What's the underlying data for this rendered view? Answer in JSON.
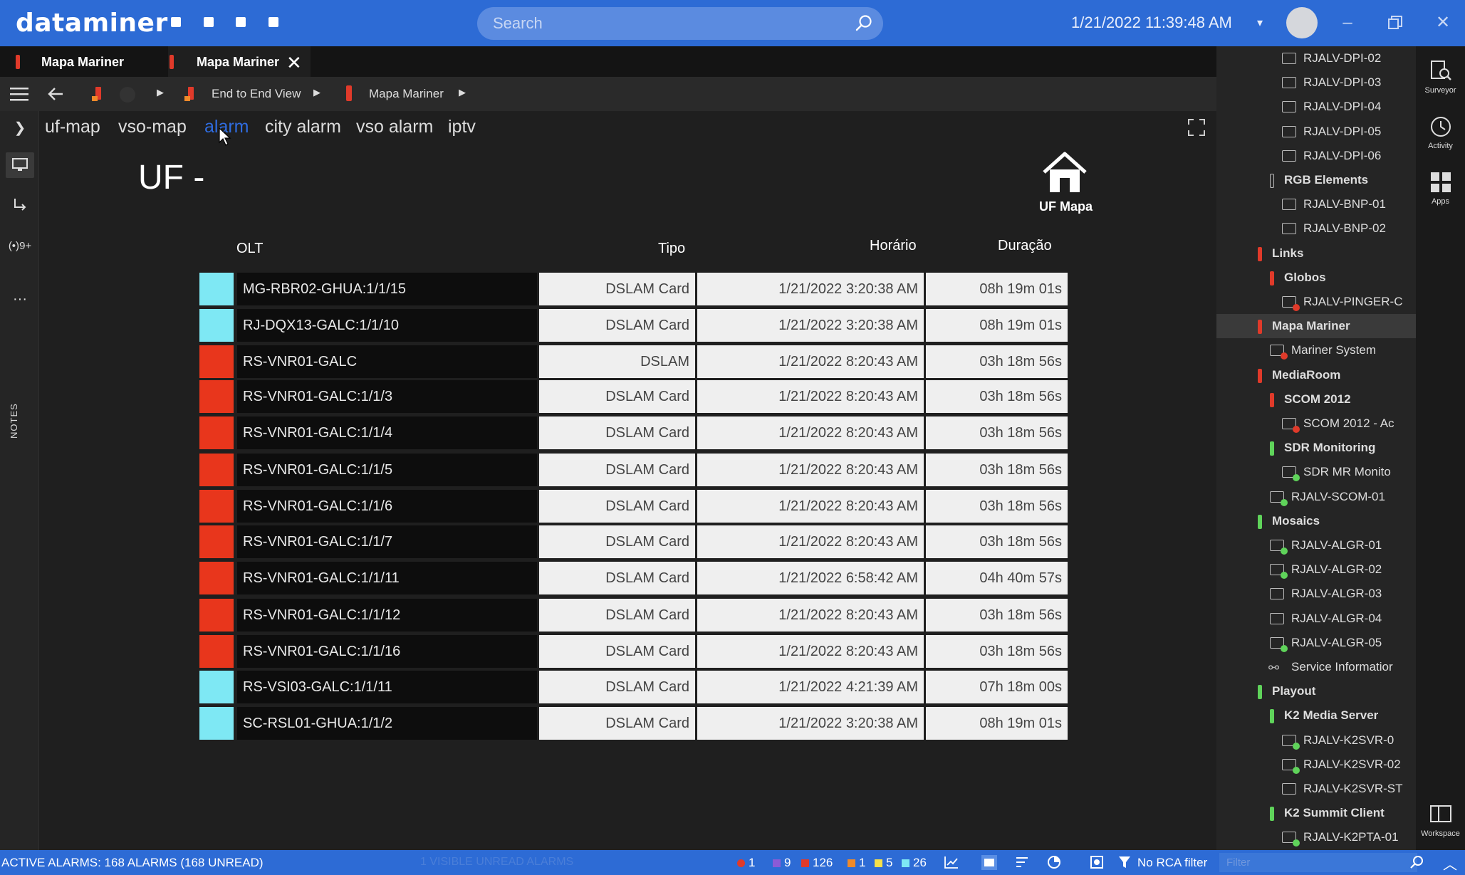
{
  "app": {
    "logo": "dataminer"
  },
  "header": {
    "search_placeholder": "Search",
    "datetime": "1/21/2022 11:39:48 AM"
  },
  "tabs": [
    {
      "label": "Mapa Mariner",
      "active": false
    },
    {
      "label": "Mapa Mariner",
      "active": true
    }
  ],
  "breadcrumb": [
    {
      "label": "End to End View"
    },
    {
      "label": "Mapa Mariner"
    }
  ],
  "nav": {
    "links": [
      "uf-map",
      "vso-map",
      "alarm",
      "city alarm",
      "vso alarm",
      "iptv"
    ],
    "active": "alarm"
  },
  "leftrail": {
    "badge": "9+",
    "notes": "NOTES"
  },
  "page": {
    "title": "UF -",
    "home_label": "UF Mapa"
  },
  "table": {
    "headers": {
      "olt": "OLT",
      "tipo": "Tipo",
      "horario": "Horário",
      "duracao": "Duração"
    },
    "rows": [
      {
        "color": "#7ee8f4",
        "olt": "MG-RBR02-GHUA:1/1/15",
        "tipo": "DSLAM Card",
        "horario": "1/21/2022 3:20:38 AM",
        "duracao": "08h 19m 01s"
      },
      {
        "color": "#7ee8f4",
        "olt": "RJ-DQX13-GALC:1/1/10",
        "tipo": "DSLAM Card",
        "horario": "1/21/2022 3:20:38 AM",
        "duracao": "08h 19m 01s"
      },
      {
        "color": "#e8361c",
        "olt": "RS-VNR01-GALC",
        "tipo": "DSLAM",
        "horario": "1/21/2022 8:20:43 AM",
        "duracao": "03h 18m 56s"
      },
      {
        "color": "#e8361c",
        "olt": "RS-VNR01-GALC:1/1/3",
        "tipo": "DSLAM Card",
        "horario": "1/21/2022 8:20:43 AM",
        "duracao": "03h 18m 56s"
      },
      {
        "color": "#e8361c",
        "olt": "RS-VNR01-GALC:1/1/4",
        "tipo": "DSLAM Card",
        "horario": "1/21/2022 8:20:43 AM",
        "duracao": "03h 18m 56s"
      },
      {
        "color": "#e8361c",
        "olt": "RS-VNR01-GALC:1/1/5",
        "tipo": "DSLAM Card",
        "horario": "1/21/2022 8:20:43 AM",
        "duracao": "03h 18m 56s"
      },
      {
        "color": "#e8361c",
        "olt": "RS-VNR01-GALC:1/1/6",
        "tipo": "DSLAM Card",
        "horario": "1/21/2022 8:20:43 AM",
        "duracao": "03h 18m 56s"
      },
      {
        "color": "#e8361c",
        "olt": "RS-VNR01-GALC:1/1/7",
        "tipo": "DSLAM Card",
        "horario": "1/21/2022 8:20:43 AM",
        "duracao": "03h 18m 56s"
      },
      {
        "color": "#e8361c",
        "olt": "RS-VNR01-GALC:1/1/11",
        "tipo": "DSLAM Card",
        "horario": "1/21/2022 6:58:42 AM",
        "duracao": "04h 40m 57s"
      },
      {
        "color": "#e8361c",
        "olt": "RS-VNR01-GALC:1/1/12",
        "tipo": "DSLAM Card",
        "horario": "1/21/2022 8:20:43 AM",
        "duracao": "03h 18m 56s"
      },
      {
        "color": "#e8361c",
        "olt": "RS-VNR01-GALC:1/1/16",
        "tipo": "DSLAM Card",
        "horario": "1/21/2022 8:20:43 AM",
        "duracao": "03h 18m 56s"
      },
      {
        "color": "#7ee8f4",
        "olt": "RS-VSI03-GALC:1/1/11",
        "tipo": "DSLAM Card",
        "horario": "1/21/2022 4:21:39 AM",
        "duracao": "07h 18m 00s"
      },
      {
        "color": "#7ee8f4",
        "olt": "SC-RSL01-GHUA:1/1/2",
        "tipo": "DSLAM Card",
        "horario": "1/21/2022 3:20:38 AM",
        "duracao": "08h 19m 01s"
      }
    ]
  },
  "tree": [
    {
      "level": 3,
      "kind": "element",
      "label": "RJALV-DPI-02",
      "dot": ""
    },
    {
      "level": 3,
      "kind": "element",
      "label": "RJALV-DPI-03",
      "dot": ""
    },
    {
      "level": 3,
      "kind": "element",
      "label": "RJALV-DPI-04",
      "dot": ""
    },
    {
      "level": 3,
      "kind": "element",
      "label": "RJALV-DPI-05",
      "dot": ""
    },
    {
      "level": 3,
      "kind": "element",
      "label": "RJALV-DPI-06",
      "dot": ""
    },
    {
      "level": 2,
      "kind": "view",
      "label": "RGB Elements",
      "bar": "#2a2a2a",
      "bold": true
    },
    {
      "level": 3,
      "kind": "element",
      "label": "RJALV-BNP-01",
      "dot": ""
    },
    {
      "level": 3,
      "kind": "element",
      "label": "RJALV-BNP-02",
      "dot": ""
    },
    {
      "level": 1,
      "kind": "view",
      "label": "Links",
      "bar": "#e03a2a",
      "bold": true
    },
    {
      "level": 2,
      "kind": "view",
      "label": "Globos",
      "bar": "#e03a2a",
      "bold": true
    },
    {
      "level": 3,
      "kind": "element",
      "label": "RJALV-PINGER-C",
      "dot": "#e03a2a"
    },
    {
      "level": 1,
      "kind": "view",
      "label": "Mapa Mariner",
      "bar": "#e03a2a",
      "bold": true,
      "selected": true
    },
    {
      "level": 2,
      "kind": "element",
      "label": "Mariner System",
      "dot": "#e03a2a"
    },
    {
      "level": 1,
      "kind": "view",
      "label": "MediaRoom",
      "bar": "#e03a2a",
      "bold": true
    },
    {
      "level": 2,
      "kind": "view",
      "label": "SCOM 2012",
      "bar": "#e03a2a",
      "bold": true
    },
    {
      "level": 3,
      "kind": "element",
      "label": "SCOM 2012 - Ac",
      "dot": "#e03a2a"
    },
    {
      "level": 2,
      "kind": "view",
      "label": "SDR Monitoring",
      "bar": "#5fd35a",
      "bold": true
    },
    {
      "level": 3,
      "kind": "element",
      "label": "SDR MR Monito",
      "dot": "#5fd35a"
    },
    {
      "level": 2,
      "kind": "element",
      "label": "RJALV-SCOM-01",
      "dot": "#5fd35a"
    },
    {
      "level": 1,
      "kind": "view",
      "label": "Mosaics",
      "bar": "#5fd35a",
      "bold": true
    },
    {
      "level": 2,
      "kind": "element",
      "label": "RJALV-ALGR-01",
      "dot": "#5fd35a"
    },
    {
      "level": 2,
      "kind": "element",
      "label": "RJALV-ALGR-02",
      "dot": "#5fd35a"
    },
    {
      "level": 2,
      "kind": "element",
      "label": "RJALV-ALGR-03",
      "dot": ""
    },
    {
      "level": 2,
      "kind": "element",
      "label": "RJALV-ALGR-04",
      "dot": ""
    },
    {
      "level": 2,
      "kind": "element",
      "label": "RJALV-ALGR-05",
      "dot": "#5fd35a"
    },
    {
      "level": 2,
      "kind": "service",
      "label": "Service Informatior",
      "dot": ""
    },
    {
      "level": 1,
      "kind": "view",
      "label": "Playout",
      "bar": "#5fd35a",
      "bold": true
    },
    {
      "level": 2,
      "kind": "view",
      "label": "K2 Media Server",
      "bar": "#5fd35a",
      "bold": true
    },
    {
      "level": 3,
      "kind": "element",
      "label": "RJALV-K2SVR-0",
      "dot": "#5fd35a"
    },
    {
      "level": 3,
      "kind": "element",
      "label": "RJALV-K2SVR-02",
      "dot": "#5fd35a"
    },
    {
      "level": 3,
      "kind": "element",
      "label": "RJALV-K2SVR-ST",
      "dot": ""
    },
    {
      "level": 2,
      "kind": "view",
      "label": "K2 Summit Client",
      "bar": "#5fd35a",
      "bold": true
    },
    {
      "level": 3,
      "kind": "element",
      "label": "RJALV-K2PTA-01",
      "dot": "#5fd35a"
    }
  ],
  "rightrail": [
    {
      "label": "Surveyor",
      "icon": "surveyor-icon"
    },
    {
      "label": "Activity",
      "icon": "activity-icon"
    },
    {
      "label": "Apps",
      "icon": "apps-icon"
    },
    {
      "label": "Workspace",
      "icon": "workspace-icon"
    }
  ],
  "statusbar": {
    "text": "ACTIVE ALARMS: 168 ALARMS (168 UNREAD)",
    "ghost": "1 VISIBLE UNREAD ALARMS",
    "counts": [
      {
        "value": "1",
        "color": "#e03a2a",
        "icon": "critical-x-icon"
      },
      {
        "value": "9",
        "color": "#8a5bd6",
        "icon": "major-square-icon"
      },
      {
        "value": "126",
        "color": "#e03a2a",
        "icon": "minor-square-icon"
      },
      {
        "value": "1",
        "color": "#f08a2a",
        "icon": "warning-square-icon"
      },
      {
        "value": "5",
        "color": "#f5e04a",
        "icon": "notice-square-icon"
      },
      {
        "value": "26",
        "color": "#7ee8f4",
        "icon": "info-square-icon"
      }
    ],
    "rca": "No RCA filter",
    "filter_placeholder": "Filter"
  }
}
